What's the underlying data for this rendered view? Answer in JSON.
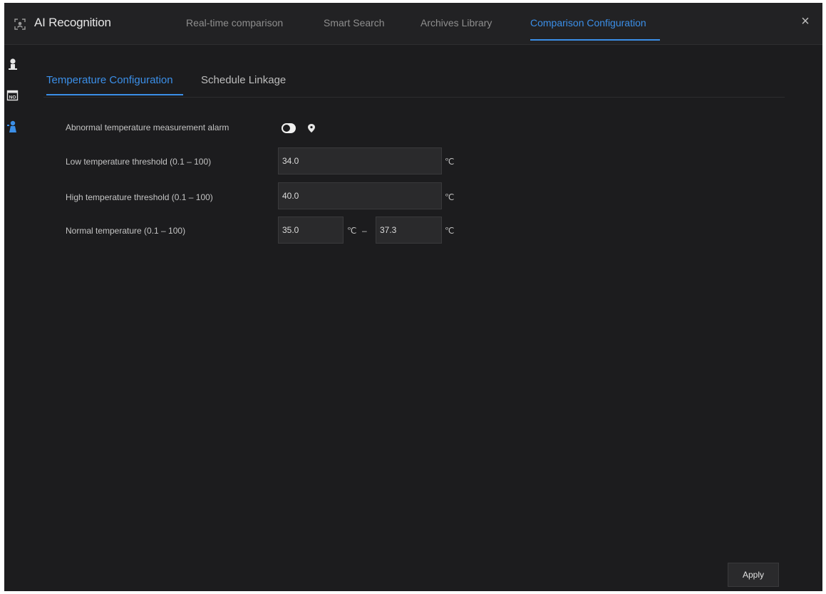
{
  "header": {
    "app_title": "AI Recognition",
    "tabs": [
      {
        "label": "Real-time comparison"
      },
      {
        "label": "Smart Search"
      },
      {
        "label": "Archives Library"
      },
      {
        "label": "Comparison Configuration"
      }
    ],
    "active_tab": "Comparison Configuration",
    "close_glyph": "×"
  },
  "sidebar": {
    "items": [
      {
        "icon": "person-icon"
      },
      {
        "icon": "license-plate-icon",
        "text": "NO"
      },
      {
        "icon": "thermometer-person-icon"
      }
    ],
    "active_icon": "thermometer-person-icon"
  },
  "subtabs": [
    {
      "label": "Temperature Configuration"
    },
    {
      "label": "Schedule Linkage"
    }
  ],
  "form": {
    "alarm_label": "Abnormal temperature measurement alarm",
    "alarm_enabled": false,
    "low_label": "Low temperature threshold (0.1 – 100)",
    "low_value": "34.0",
    "high_label": "High temperature threshold (0.1 – 100)",
    "high_value": "40.0",
    "normal_label": "Normal temperature (0.1 – 100)",
    "normal_min": "35.0",
    "normal_max": "37.3",
    "unit": "℃",
    "range_sep": "–"
  },
  "apply_label": "Apply",
  "colors": {
    "accent": "#3b8fe8",
    "background": "#1c1c1e"
  }
}
